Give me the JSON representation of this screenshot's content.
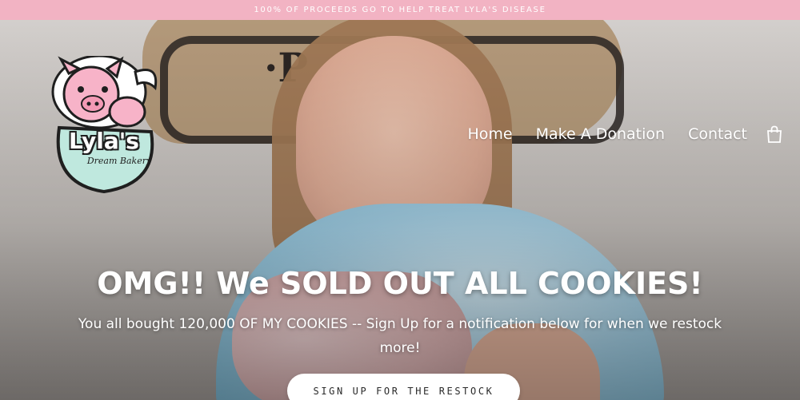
{
  "announcement": {
    "text": "100% OF PROCEEDS GO TO HELP TREAT LYLA'S DISEASE"
  },
  "logo": {
    "name": "Lyla's",
    "tagline": "Dream Bakery"
  },
  "nav": {
    "items": [
      {
        "label": "Home"
      },
      {
        "label": "Make A Donation"
      },
      {
        "label": "Contact"
      }
    ],
    "cart_icon": "shopping-bag-icon"
  },
  "hero": {
    "headline": "OMG!! We SOLD OUT ALL COOKIES!",
    "subtext": "You all bought 120,000 OF MY COOKIES -- Sign Up for a notification below for when we restock more!",
    "cta_label": "SIGN UP FOR THE RESTOCK"
  },
  "colors": {
    "announcement_bg": "#f2b3c3",
    "text_on_hero": "#ffffff"
  }
}
